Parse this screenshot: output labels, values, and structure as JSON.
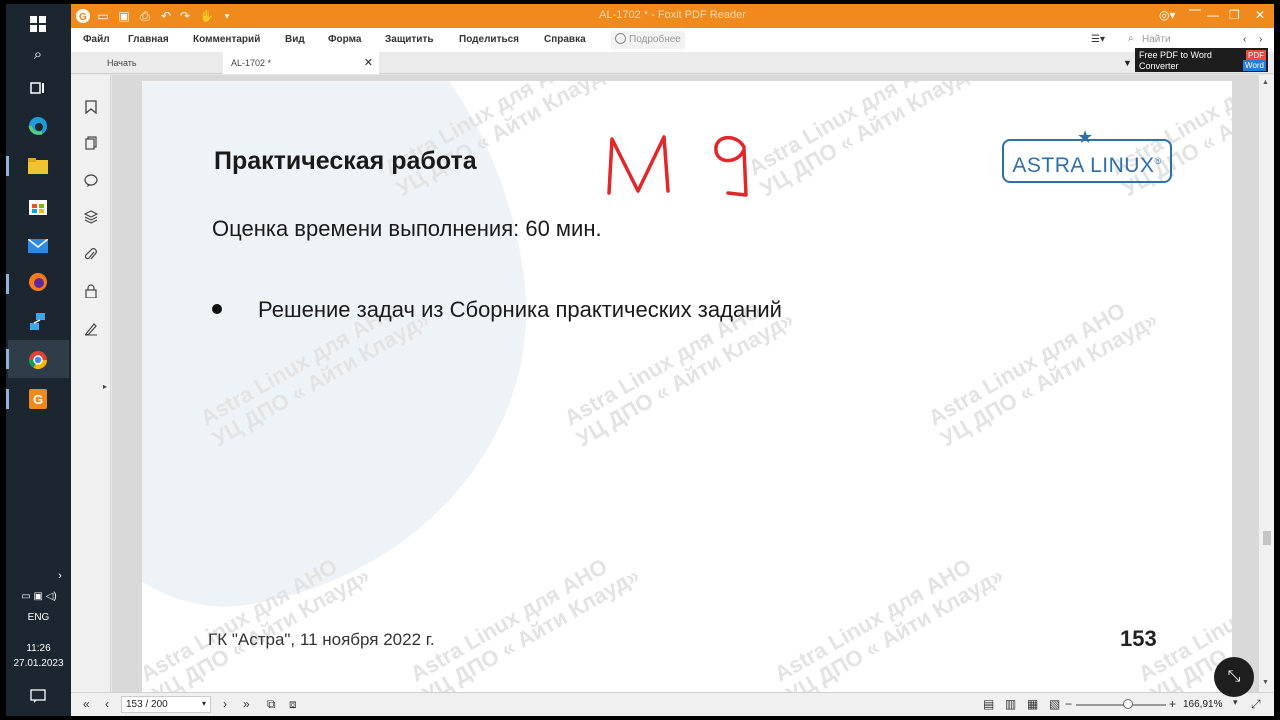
{
  "window": {
    "title": "AL-1702 * - Foxit PDF Reader",
    "controls": [
      "account-icon",
      "minimize-icon",
      "restore-icon",
      "close-icon"
    ]
  },
  "menu": {
    "items": [
      "Файл",
      "Главная",
      "Комментарий",
      "Вид",
      "Форма",
      "Защитить",
      "Поделиться",
      "Справка"
    ],
    "tell_me": "Подробнее",
    "search_placeholder": "Найти"
  },
  "ad": {
    "line1": "Free PDF to Word",
    "line2": "Converter",
    "pdf": "PDF",
    "word": "Word"
  },
  "tabs": [
    {
      "label": "Начать"
    },
    {
      "label": "AL-1702 *"
    }
  ],
  "slide": {
    "title": "Практическая работа",
    "annotation": "М 9",
    "subtitle": "Оценка времени выполнения: 60 мин.",
    "bullet": "Решение задач из Сборника практических заданий",
    "footer": "ГК \"Астра\", 11 ноября 2022 г.",
    "page_number": "153",
    "logo": "ASTRA LINUX",
    "logo_mark": "®",
    "watermark_line1": "Astra Linux для АНО",
    "watermark_line2": "УЦ ДПО « Айти Клауд»"
  },
  "status": {
    "page_field": "153 / 200",
    "zoom": "166,91%"
  },
  "taskbar": {
    "language": "ENG",
    "time": "11:26",
    "date": "27.01.2023"
  }
}
